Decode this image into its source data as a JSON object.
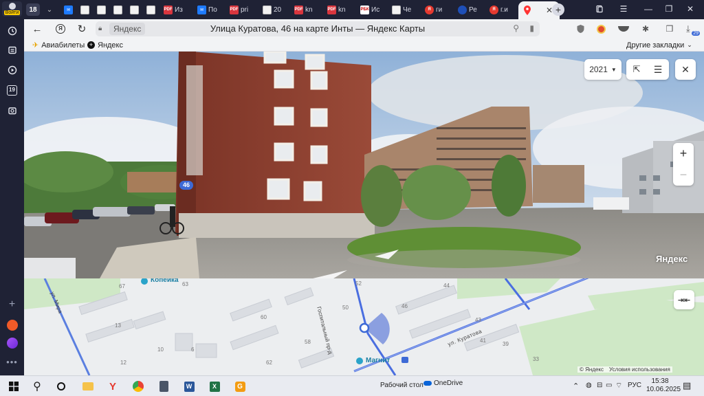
{
  "sidebar": {
    "login_label": "Войти",
    "badge_19": "19"
  },
  "tabs": {
    "count": "18",
    "items": [
      {
        "icon": "pdf",
        "label": "Из"
      },
      {
        "icon": "mail",
        "label": "По"
      },
      {
        "icon": "pdf",
        "label": "pri"
      },
      {
        "icon": "doc",
        "label": "20"
      },
      {
        "icon": "pdf",
        "label": "kn"
      },
      {
        "icon": "pdf",
        "label": "kn"
      },
      {
        "icon": "rbc",
        "label": "Ис"
      },
      {
        "icon": "doc",
        "label": "Че"
      },
      {
        "icon": "yandex-search",
        "label": "ги"
      },
      {
        "icon": "shield",
        "label": "Ре"
      },
      {
        "icon": "yandex-search",
        "label": "г.и"
      },
      {
        "icon": "maps-pin",
        "label": ""
      }
    ],
    "active_favicon_label": "",
    "new_tab_label": "+"
  },
  "addressbar": {
    "host": "Яндекс",
    "title": "Улица Куратова, 46 на карте Инты — Яндекс Карты",
    "downloads_badge": "29"
  },
  "bookmarks": {
    "items": [
      {
        "icon": "plane-icon",
        "label": "Авиабилеты"
      },
      {
        "icon": "yandex-plus-icon",
        "label": "Яндекс"
      }
    ],
    "other_label": "Другие закладки"
  },
  "panorama": {
    "year": "2021",
    "house_number": "46",
    "watermark": "Яндекс"
  },
  "map": {
    "poi": [
      {
        "name": "Копейка"
      },
      {
        "name": "Магнит"
      }
    ],
    "street_kuratova": "ул. Куратова",
    "street_gospitalnyi": "Госпитальный пр-д",
    "street_left": "ул. Мира",
    "house_labels": [
      "67",
      "63",
      "44",
      "52",
      "50",
      "46",
      "43",
      "60",
      "41",
      "39",
      "33",
      "13",
      "10",
      "62",
      "58",
      "12",
      "6"
    ],
    "copyright": "© Яндекс",
    "terms": "Условия использования"
  },
  "taskbar": {
    "desktop_label": "Рабочий стол",
    "onedrive_label": "OneDrive",
    "lang": "РУС",
    "time": "15:38",
    "date": "10.06.2025"
  },
  "colors": {
    "accent_blue": "#3d6ad6",
    "route_blue": "#4a6ee0",
    "sidebar_bg": "#1f2235"
  }
}
